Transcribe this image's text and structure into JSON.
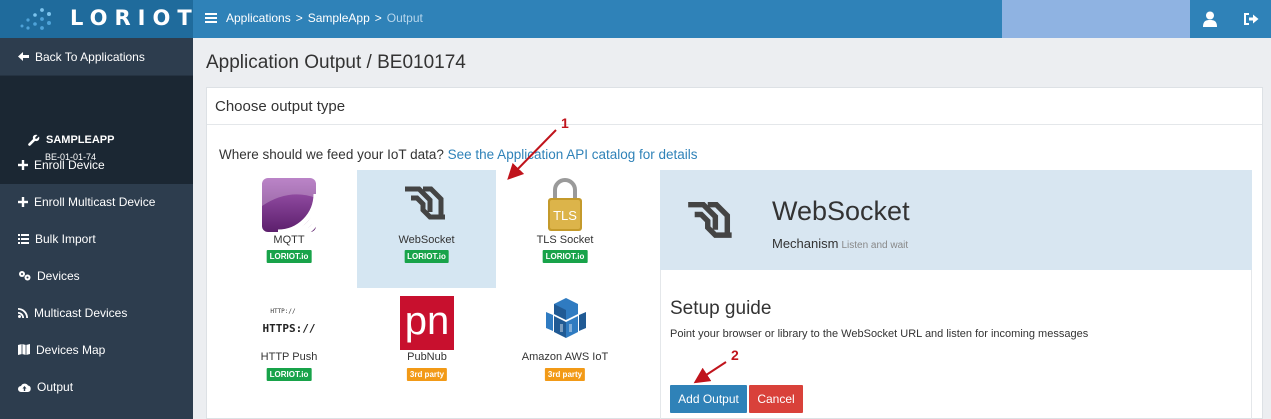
{
  "topbar": {
    "logo": "LORIOT",
    "breadcrumb": [
      "Applications",
      "SampleApp",
      "Output"
    ],
    "breadcrumb_sep": ">"
  },
  "sidebar": {
    "back_label": "Back To Applications",
    "app_name": "SAMPLEAPP",
    "app_id": "BE-01-01-74",
    "items": [
      {
        "label": "Enroll Device",
        "icon": "plus-icon"
      },
      {
        "label": "Enroll Multicast Device",
        "icon": "plus-icon"
      },
      {
        "label": "Bulk Import",
        "icon": "list-icon"
      },
      {
        "label": "Devices",
        "icon": "devices-icon"
      },
      {
        "label": "Multicast Devices",
        "icon": "rss-icon"
      },
      {
        "label": "Devices Map",
        "icon": "map-icon"
      },
      {
        "label": "Output",
        "icon": "cloud-upload-icon"
      }
    ]
  },
  "main": {
    "page_title": "Application Output / BE010174",
    "panel_title": "Choose output type",
    "question": "Where should we feed your IoT data? ",
    "question_link": "See the Application API catalog for details",
    "output_types": [
      {
        "label": "MQTT",
        "badge": "LORIOT.io",
        "badge_kind": "loriot"
      },
      {
        "label": "WebSocket",
        "badge": "LORIOT.io",
        "badge_kind": "loriot",
        "selected": true
      },
      {
        "label": "TLS Socket",
        "badge": "LORIOT.io",
        "badge_kind": "loriot",
        "icon_text": "TLS"
      },
      {
        "label": "HTTP Push",
        "badge": "LORIOT.io",
        "badge_kind": "loriot",
        "icon_text_small": "HTTP://",
        "icon_text_big": "HTTPS://"
      },
      {
        "label": "PubNub",
        "badge": "3rd party",
        "badge_kind": "third",
        "icon_text": "pn"
      },
      {
        "label": "Amazon AWS IoT",
        "badge": "3rd party",
        "badge_kind": "third"
      }
    ],
    "detail": {
      "title": "WebSocket",
      "mechanism": "Mechanism",
      "mechanism_sub": "Listen and wait",
      "setup_title": "Setup guide",
      "setup_desc": "Point your browser or library to the WebSocket URL and listen for incoming messages",
      "add_label": "Add Output",
      "cancel_label": "Cancel"
    },
    "annotations": [
      "1",
      "2"
    ]
  },
  "colors": {
    "topbar": "#2f82b8",
    "sidebar": "#2d3d4e",
    "accent": "#2f82b8",
    "loriot_badge": "#18a34a",
    "third_badge": "#f29a17",
    "cancel": "#d9413a",
    "annotation": "#c0141c"
  }
}
